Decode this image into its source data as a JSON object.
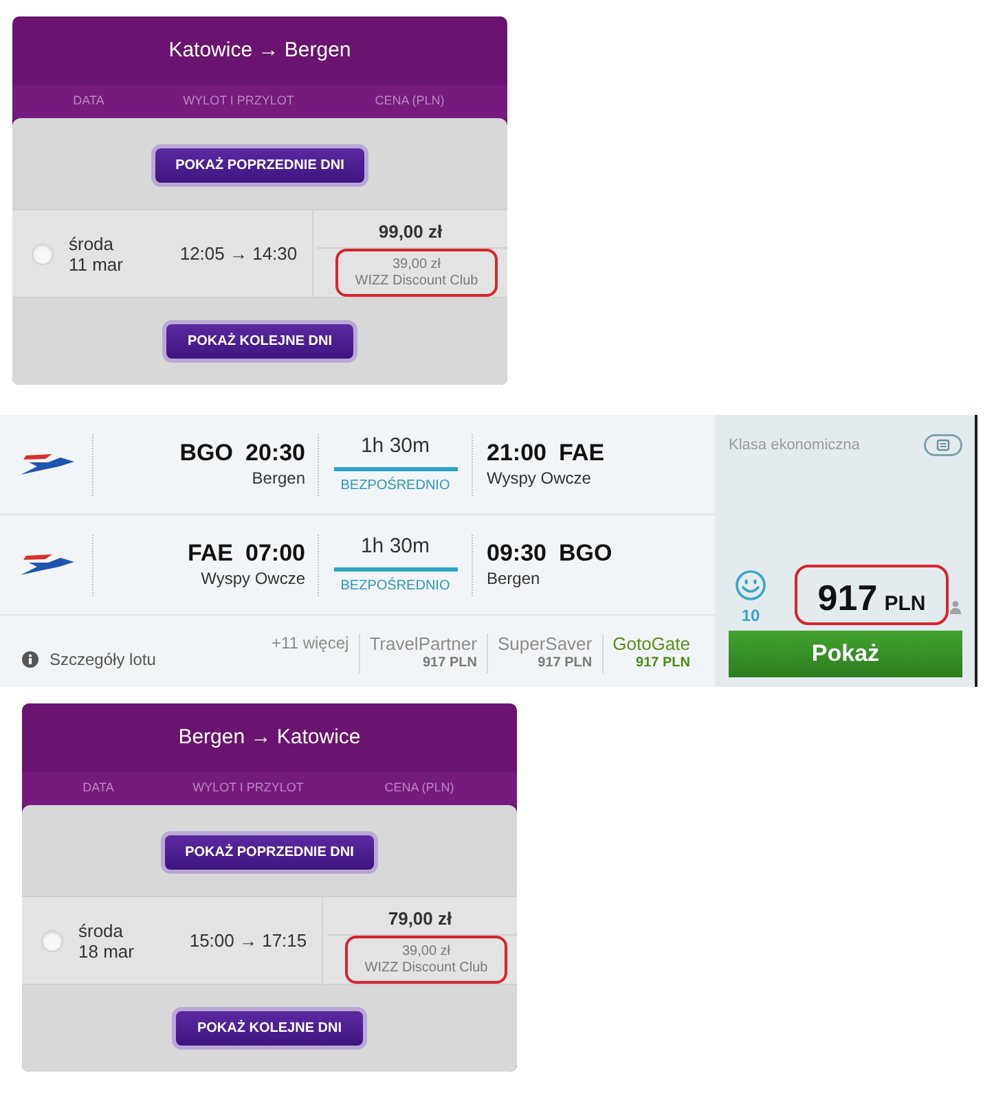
{
  "sections": [
    {
      "kind": "fare_card",
      "title": "Katowice → Bergen",
      "columns": [
        "DATA",
        "WYLOT I PRZYLOT",
        "CENA (PLN)"
      ],
      "previous_button": "POKAŻ POPRZEDNIE DNI",
      "rows": [
        {
          "selected": false,
          "weekday": "środa",
          "date": "11 mar",
          "times": "12:05 → 14:30",
          "price": "99,00 zł",
          "club_price": "39,00 zł",
          "club_label": "WIZZ Discount Club",
          "highlighted": true
        }
      ],
      "next_button": "POKAŻ KOLEJNE DNI"
    },
    {
      "kind": "itinerary",
      "legs": [
        {
          "from_code": "BGO",
          "departure": "20:30",
          "from_city": "Bergen",
          "duration": "1h 30m",
          "stops": "BEZPOŚREDNIO",
          "arrival": "21:00",
          "to_code": "FAE",
          "to_city": "Wyspy Owcze"
        },
        {
          "from_code": "FAE",
          "departure": "07:00",
          "from_city": "Wyspy Owcze",
          "duration": "1h 30m",
          "stops": "BEZPOŚREDNIO",
          "arrival": "09:30",
          "to_code": "BGO",
          "to_city": "Bergen"
        }
      ],
      "details_link": "Szczegóły lotu",
      "more_offers": "+11 więcej",
      "providers": [
        {
          "name": "TravelPartner",
          "price": "917 PLN",
          "featured": false
        },
        {
          "name": "SuperSaver",
          "price": "917 PLN",
          "featured": false
        },
        {
          "name": "GotoGate",
          "price": "917 PLN",
          "featured": true
        }
      ],
      "cabin_class": "Klasa ekonomiczna",
      "rating": "10",
      "price": {
        "amount": "917",
        "currency": "PLN",
        "highlighted": true
      },
      "button": "Pokaż"
    },
    {
      "kind": "fare_card",
      "title": "Bergen → Katowice",
      "columns": [
        "DATA",
        "WYLOT I PRZYLOT",
        "CENA (PLN)"
      ],
      "previous_button": "POKAŻ POPRZEDNIE DNI",
      "rows": [
        {
          "selected": false,
          "weekday": "środa",
          "date": "18 mar",
          "times": "15:00 → 17:15",
          "price": "79,00 zł",
          "club_price": "39,00 zł",
          "club_label": "WIZZ Discount Club",
          "highlighted": true
        }
      ],
      "next_button": "POKAŻ KOLEJNE DNI"
    }
  ]
}
